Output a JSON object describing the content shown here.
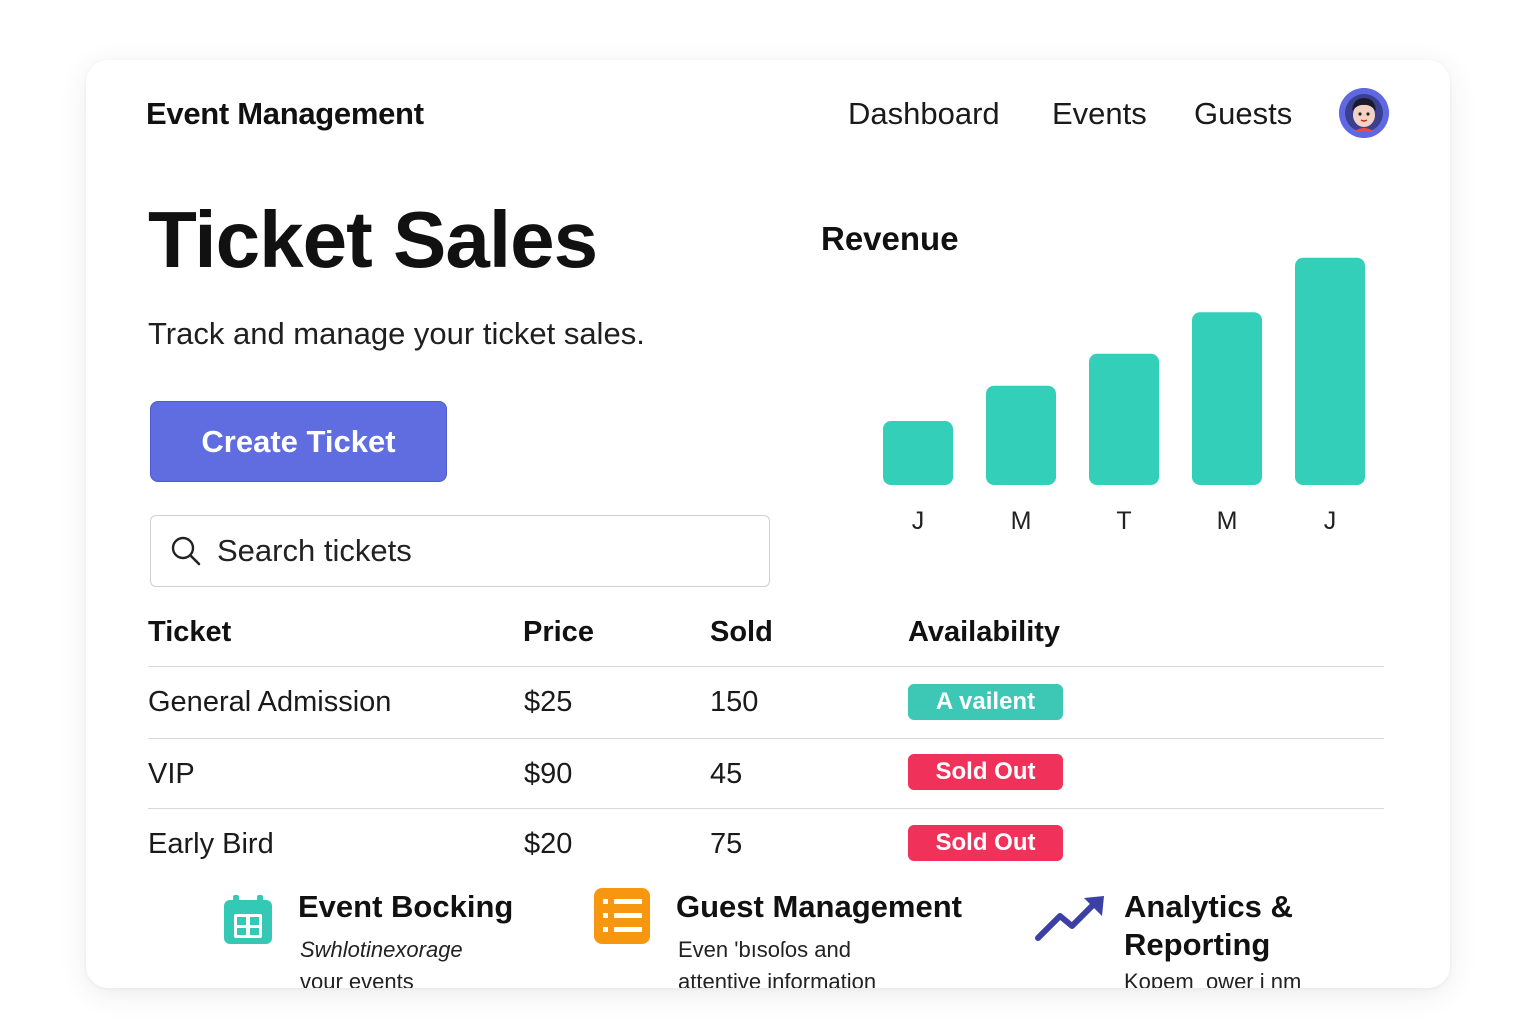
{
  "header": {
    "brand": "Event Management",
    "nav": [
      "Dashboard",
      "Events",
      "Guests"
    ]
  },
  "page": {
    "title": "Ticket Sales",
    "subtitle": "Track and manage your ticket sales.",
    "create_button": "Create Ticket",
    "search_placeholder": "Search tickets"
  },
  "table": {
    "headers": [
      "Ticket",
      "Price",
      "Sold",
      "Availability"
    ],
    "rows": [
      {
        "ticket": "General Admission",
        "price": "$25",
        "sold": "150",
        "availability": "A vailent"
      },
      {
        "ticket": "VIP",
        "price": "$90",
        "sold": "45",
        "availability": "Sold Out"
      },
      {
        "ticket": "Early Bird",
        "price": "$20",
        "sold": "75",
        "availability": "Sold Out"
      }
    ]
  },
  "chart_data": {
    "type": "bar",
    "title": "Revenue",
    "categories": [
      "J",
      "M",
      "T",
      "M",
      "J"
    ],
    "values": [
      20,
      31,
      41,
      54,
      71
    ],
    "ylim": [
      0,
      75
    ],
    "grid": false,
    "bar_color": "#34cfb8"
  },
  "features": [
    {
      "title": "Event Bocking",
      "desc1": "Swhlotinexorage",
      "desc2": "vour events",
      "icon": "calendar-icon"
    },
    {
      "title": "Guest Management",
      "desc1": "Even 'bısoſos and",
      "desc2": "attentive information",
      "icon": "list-icon"
    },
    {
      "title": "Analytics &",
      "title2": "Reporting",
      "desc1": "Kopem_ower i nm",
      "icon": "trend-up-icon"
    }
  ],
  "colors": {
    "accent": "#5f6de0",
    "available": "#3cc8b4",
    "sold_out": "#f0325a",
    "chart": "#34cfb8",
    "analytics_icon": "#3b3fa6",
    "calendar_icon": "#34c9b4",
    "list_icon": "#f7960f"
  }
}
